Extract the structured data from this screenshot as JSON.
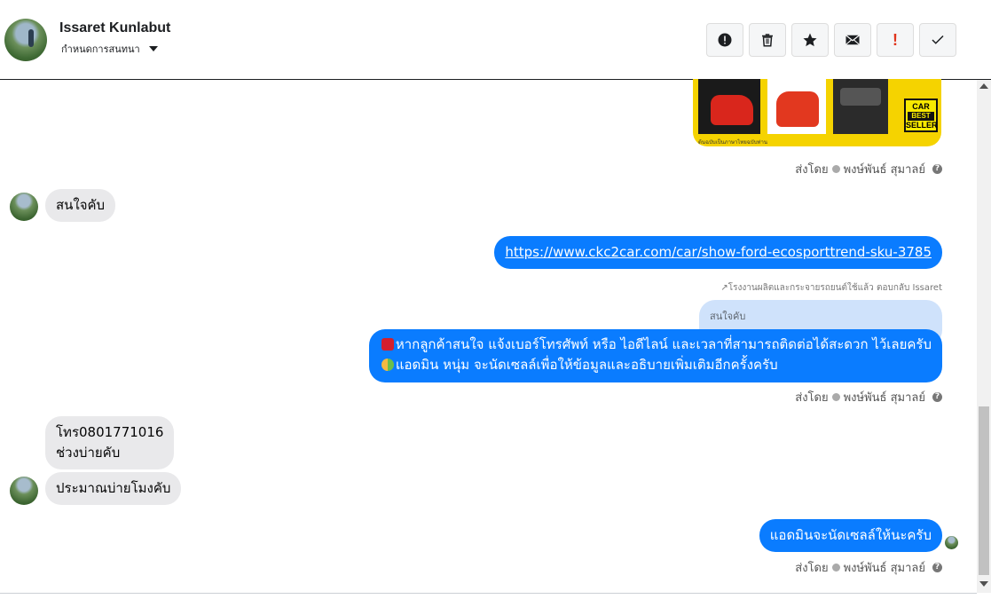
{
  "header": {
    "name": "Issaret Kunlabut",
    "subtitle": "กำหนดการสนทนา",
    "actions": [
      {
        "icon": "alert-circle-icon"
      },
      {
        "icon": "trash-icon"
      },
      {
        "icon": "star-icon"
      },
      {
        "icon": "mail-icon"
      },
      {
        "icon": "exclamation-icon",
        "label": "!"
      },
      {
        "icon": "checkmark-icon"
      }
    ]
  },
  "ad_image": {
    "badge_line1": "CAR",
    "badge_line2": "BEST",
    "badge_line3": "SELLER",
    "caption": "ต้นฉบับเป็นภาษาไทยฉบับท่าน"
  },
  "messages": {
    "sent_by_1": "ส่งโดย",
    "sender_name_1": "พงษ์พันธ์ สุมาลย์",
    "incoming_1": "สนใจคับ",
    "outgoing_link": "https://www.ckc2car.com/car/show-ford-ecosporttrend-sku-3785",
    "reply_note": "↗โรงงานผลิตและกระจายรถยนต์ใช้แล้ว ตอบกลับ Issaret",
    "quoted_text": "สนใจคับ",
    "outgoing_2_line1": "หากลูกค้าสนใจ แจ้งเบอร์โทรศัพท์ หรือ ไอดีไลน์ และเวลาที่สามารถติดต่อได้สะดวก ไว้เลยครับ",
    "outgoing_2_line2": "แอดมิน หนุ่ม จะนัดเซลล์เพื่อให้ข้อมูลและอธิบายเพิ่มเติมอีกครั้งครับ",
    "sent_by_2": "ส่งโดย",
    "sender_name_2": "พงษ์พันธ์ สุมาลย์",
    "incoming_2_line1": "โทร0801771016",
    "incoming_2_line2": "ช่วงบ่ายคับ",
    "incoming_3": "ประมาณบ่ายโมงคับ",
    "outgoing_3": "แอดมินจะนัดเซลล์ให้นะครับ",
    "sent_by_3": "ส่งโดย",
    "sender_name_3": "พงษ์พันธ์ สุมาลย์"
  }
}
